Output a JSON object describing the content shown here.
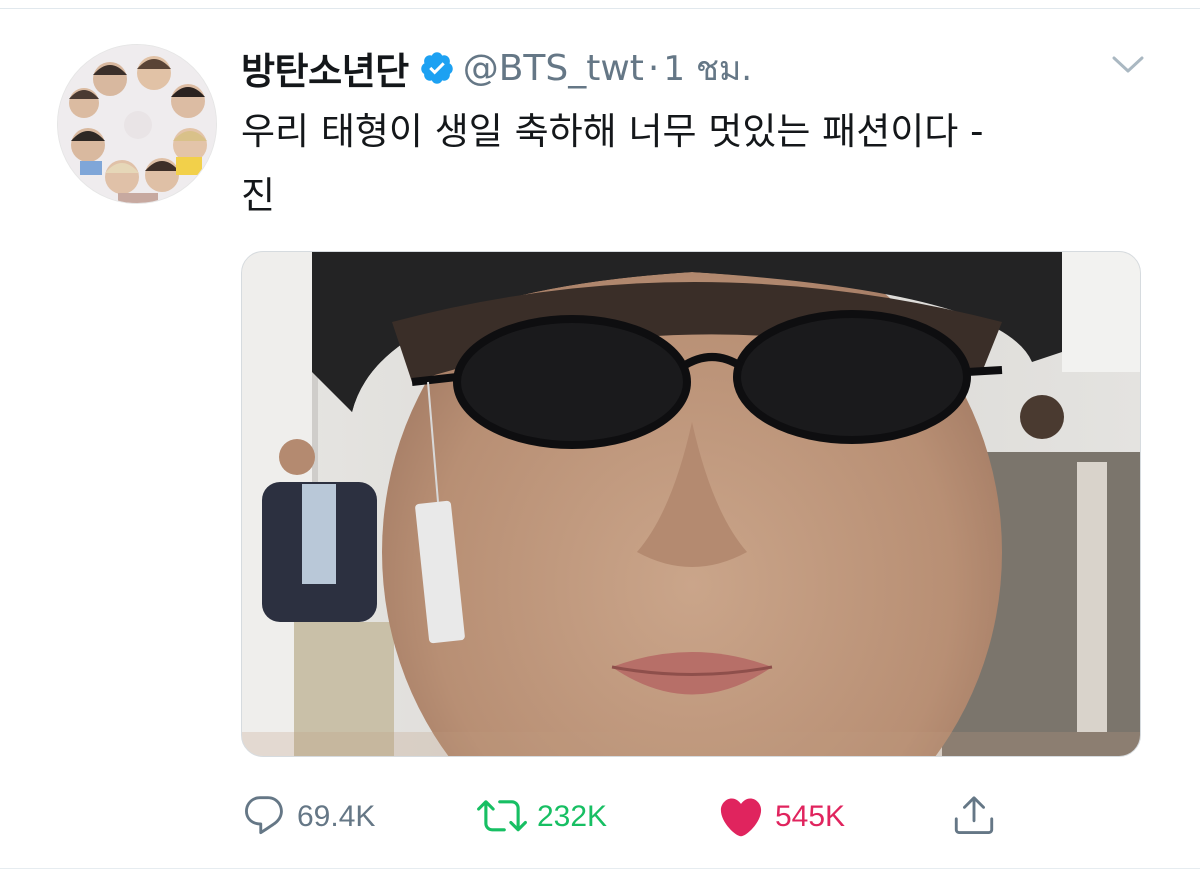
{
  "tweet": {
    "display_name": "방탄소년단",
    "verified": true,
    "handle": "@BTS_twt",
    "separator": "·",
    "time": "1 ชม.",
    "text": "우리 태형이 생일 축하해 너무 멋있는 패션이다 -\n진",
    "media_icon": "photo"
  },
  "actions": {
    "reply_count": "69.4K",
    "retweet_count": "232K",
    "like_count": "545K",
    "share_icon": "share-icon"
  },
  "colors": {
    "verified": "#1da1f2",
    "retweet": "#17bf63",
    "like": "#e0245e",
    "secondary_text": "#657786"
  }
}
